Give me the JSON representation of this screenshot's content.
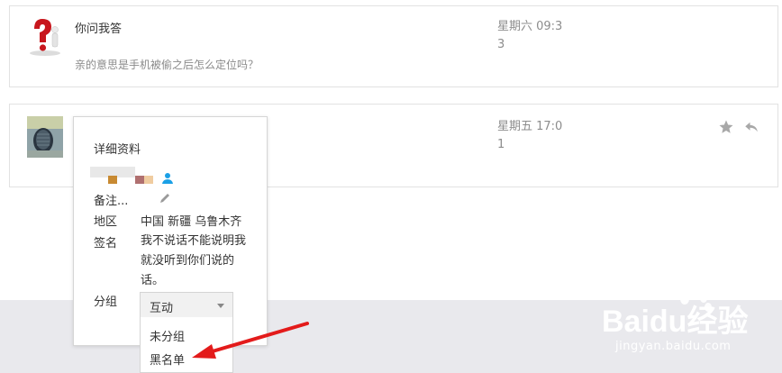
{
  "messages": [
    {
      "sender": "你问我答",
      "snippet": "亲的意思是手机被偷之后怎么定位吗？",
      "time": "星期六 09:3",
      "count": "3",
      "avatar": "question-mark-figure-avatar"
    },
    {
      "sender": "",
      "snippet": "",
      "time": "星期五 17:0",
      "count": "1",
      "avatar": "photo-avatar",
      "actions": [
        "star-icon",
        "reply-icon"
      ]
    }
  ],
  "profile_popup": {
    "title": "详细资料",
    "remark_label": "备注...",
    "region_label": "地区",
    "region_value": "中国 新疆 乌鲁木齐",
    "signature_label": "签名",
    "signature_value": "我不说话不能说明我就没听到你们说的话。",
    "group_label": "分组",
    "group_selected": "互动",
    "group_options": [
      "未分组",
      "黑名单"
    ]
  },
  "watermark": {
    "brand": "Baidu经验",
    "url": "jingyan.baidu.com"
  },
  "colors": {
    "accent_arrow": "#e31b1b",
    "badge_blue": "#1aa0e6",
    "page_gray": "#e9e9ed"
  }
}
